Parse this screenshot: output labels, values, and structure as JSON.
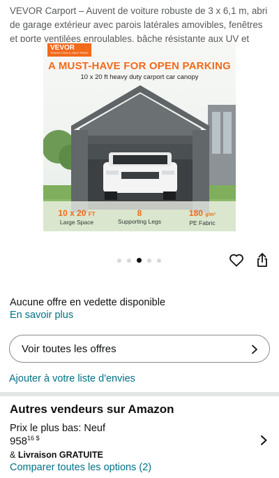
{
  "product": {
    "title": "VEVOR Carport – Auvent de voiture robuste de 3 x 6,1 m, abri de garage extérieur avec parois latérales amovibles, fenêtres et porte ventilées enroulables, bâche résistante aux UV et imperméable pour"
  },
  "image": {
    "brand": "VEVOR",
    "brand_tagline": "TOUGH TOOLS, HALF PRICE",
    "headline": "A MUST-HAVE FOR OPEN PARKING",
    "subhead": "10 x 20 ft heavy duty carport car canopy",
    "specs": [
      {
        "value": "10 x 20",
        "unit": "FT",
        "label": "Large Space"
      },
      {
        "value": "8",
        "unit": "",
        "label": "Supporting Legs"
      },
      {
        "value": "180",
        "unit": "g/m²",
        "label": "PE Fabric"
      }
    ]
  },
  "carousel": {
    "count": 5,
    "active_index": 2
  },
  "icons": {
    "favorite": "heart-icon",
    "share": "share-icon",
    "chevron": "chevron-right-icon"
  },
  "offers": {
    "no_featured": "Aucune offre en vedette disponible",
    "learn_more": "En savoir plus",
    "see_all": "Voir toutes les offres",
    "add_to_wishlist": "Ajouter à votre liste d'envies"
  },
  "other_sellers": {
    "title": "Autres vendeurs sur Amazon",
    "lowest_price_label": "Prix le plus bas: Neuf",
    "price_whole": "958",
    "price_fraction": "16",
    "price_currency": "$",
    "delivery_prefix": "& ",
    "delivery_text": "Livraison GRATUITE",
    "compare": "Comparer toutes les options (2)"
  },
  "colors": {
    "link": "#007185",
    "accent": "#f26a1b",
    "text": "#0f1111",
    "muted": "#565959"
  }
}
